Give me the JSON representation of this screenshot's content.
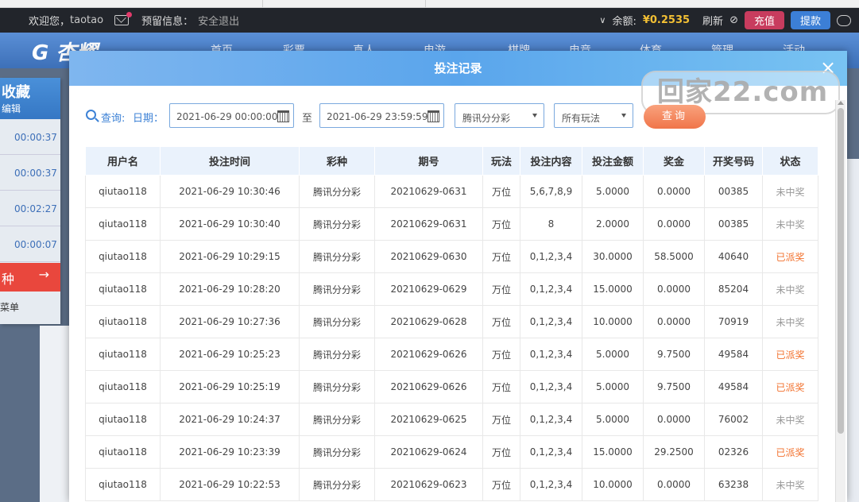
{
  "topbar": {
    "welcome": "欢迎您，",
    "username": "taotao",
    "notice_label": "预留信息：",
    "logout": "安全退出",
    "balance_label": "余额:",
    "balance_value": "¥0.2535",
    "refresh": "刷新",
    "recharge": "充值",
    "withdraw": "提款"
  },
  "nav": {
    "logo": "G 杏耀",
    "items": [
      "首页",
      "彩票",
      "真人",
      "电游",
      "棋牌",
      "电竞",
      "体育",
      "管理",
      "活动"
    ]
  },
  "leftpanel": {
    "title": "收藏",
    "subtitle": "编辑",
    "timers": [
      "00:00:37",
      "00:00:37",
      "00:02:27",
      "00:00:07"
    ],
    "red_item": "种",
    "menu": "菜单"
  },
  "modal": {
    "title": "投注记录",
    "close": "×",
    "watermark": "回家22.com"
  },
  "filter": {
    "query_label": "查询:",
    "date_label": "日期：",
    "start_date": "2021-06-29 00:00:00",
    "to_label": "至",
    "end_date": "2021-06-29 23:59:59",
    "lottery_select": "腾讯分分彩",
    "play_select": "所有玩法",
    "query_button": "查询"
  },
  "table": {
    "headers": [
      "用户名",
      "投注时间",
      "彩种",
      "期号",
      "玩法",
      "投注内容",
      "投注金额",
      "奖金",
      "开奖号码",
      "状态"
    ],
    "rows": [
      [
        "qiutao118",
        "2021-06-29 10:30:46",
        "腾讯分分彩",
        "20210629-0631",
        "万位",
        "5,6,7,8,9",
        "5.0000",
        "0.0000",
        "00385",
        "未中奖"
      ],
      [
        "qiutao118",
        "2021-06-29 10:30:40",
        "腾讯分分彩",
        "20210629-0631",
        "万位",
        "8",
        "2.0000",
        "0.0000",
        "00385",
        "未中奖"
      ],
      [
        "qiutao118",
        "2021-06-29 10:29:15",
        "腾讯分分彩",
        "20210629-0630",
        "万位",
        "0,1,2,3,4",
        "30.0000",
        "58.5000",
        "40640",
        "已派奖"
      ],
      [
        "qiutao118",
        "2021-06-29 10:28:20",
        "腾讯分分彩",
        "20210629-0629",
        "万位",
        "0,1,2,3,4",
        "15.0000",
        "0.0000",
        "85204",
        "未中奖"
      ],
      [
        "qiutao118",
        "2021-06-29 10:27:36",
        "腾讯分分彩",
        "20210629-0628",
        "万位",
        "0,1,2,3,4",
        "10.0000",
        "0.0000",
        "70919",
        "未中奖"
      ],
      [
        "qiutao118",
        "2021-06-29 10:25:23",
        "腾讯分分彩",
        "20210629-0626",
        "万位",
        "0,1,2,3,4",
        "5.0000",
        "9.7500",
        "49584",
        "已派奖"
      ],
      [
        "qiutao118",
        "2021-06-29 10:25:19",
        "腾讯分分彩",
        "20210629-0626",
        "万位",
        "0,1,2,3,4",
        "5.0000",
        "9.7500",
        "49584",
        "已派奖"
      ],
      [
        "qiutao118",
        "2021-06-29 10:24:37",
        "腾讯分分彩",
        "20210629-0625",
        "万位",
        "0,1,2,3,4",
        "5.0000",
        "0.0000",
        "76002",
        "未中奖"
      ],
      [
        "qiutao118",
        "2021-06-29 10:23:39",
        "腾讯分分彩",
        "20210629-0624",
        "万位",
        "0,1,2,3,4",
        "15.0000",
        "29.2500",
        "02326",
        "已派奖"
      ],
      [
        "qiutao118",
        "2021-06-29 10:22:53",
        "腾讯分分彩",
        "20210629-0623",
        "万位",
        "0,1,2,3,4",
        "10.0000",
        "0.0000",
        "63238",
        "未中奖"
      ]
    ]
  },
  "colors": {
    "status_paid": "#f2702c",
    "status_none": "#999999",
    "accent": "#3d82d6"
  }
}
